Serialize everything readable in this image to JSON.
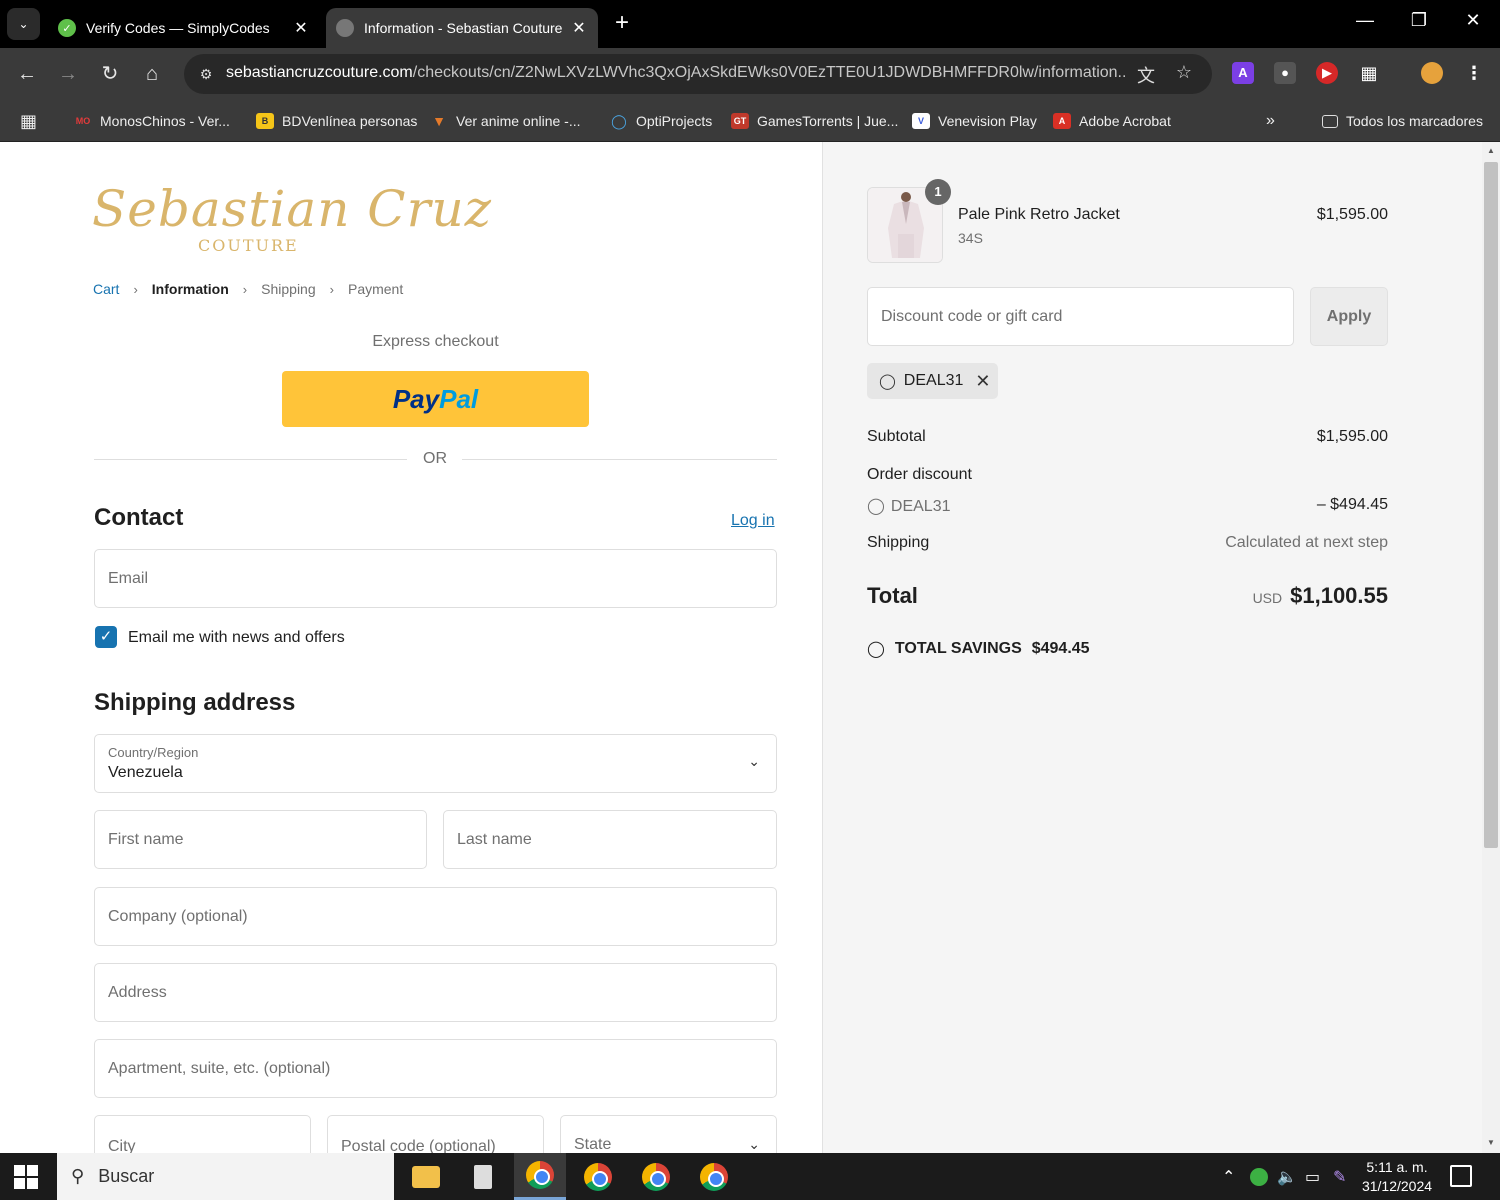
{
  "browser": {
    "tabs": [
      {
        "title": "Verify Codes — SimplyCodes",
        "favicon": "simplycodes-icon"
      },
      {
        "title": "Information - Sebastian Couture",
        "favicon": "globe-icon"
      }
    ],
    "url_host": "sebastiancruzcouture.com",
    "url_path": "/checkouts/cn/Z2NwLXVzLWVhc3QxOjAxSkdEWks0V0EzTTE0U1JDWDBHMFFDR0lw/information...",
    "bookmarks": [
      {
        "label": "MonosChinos - Ver...",
        "icon": "mo",
        "color": "#e23b3b"
      },
      {
        "label": "BDVenlínea personas",
        "icon": "bdv",
        "color": "#f5c518"
      },
      {
        "label": "Ver anime online -...",
        "icon": "anime",
        "color": "#e57a2a"
      },
      {
        "label": "OptiProjects",
        "icon": "O",
        "color": "#4aa3df"
      },
      {
        "label": "GamesTorrents | Jue...",
        "icon": "GT",
        "color": "#c0392b"
      },
      {
        "label": "Venevision Play",
        "icon": "V",
        "color": "#3b5bdb"
      },
      {
        "label": "Adobe Acrobat",
        "icon": "A",
        "color": "#d93025"
      }
    ],
    "all_bookmarks": "Todos los marcadores"
  },
  "checkout": {
    "brand": {
      "script": "Sebastian Cruz",
      "sub": "COUTURE"
    },
    "breadcrumb": {
      "cart": "Cart",
      "information": "Information",
      "shipping": "Shipping",
      "payment": "Payment"
    },
    "express_checkout": "Express checkout",
    "paypal": {
      "part1": "Pay",
      "part2": "Pal"
    },
    "or": "OR",
    "contact": {
      "heading": "Contact",
      "login": "Log in",
      "email_placeholder": "Email",
      "newsletter": "Email me with news and offers"
    },
    "shipping": {
      "heading": "Shipping address",
      "country_label": "Country/Region",
      "country_value": "Venezuela",
      "first_name": "First name",
      "last_name": "Last name",
      "company": "Company (optional)",
      "address": "Address",
      "apartment": "Apartment, suite, etc. (optional)",
      "city": "City",
      "postal": "Postal code (optional)",
      "state": "State"
    }
  },
  "summary": {
    "item": {
      "name": "Pale Pink Retro Jacket",
      "variant": "34S",
      "price": "$1,595.00",
      "quantity": "1"
    },
    "discount_placeholder": "Discount code or gift card",
    "apply": "Apply",
    "applied_code": "DEAL31",
    "subtotal_label": "Subtotal",
    "subtotal": "$1,595.00",
    "order_discount_label": "Order discount",
    "discount_code": "DEAL31",
    "discount_amount": "– $494.45",
    "shipping_label": "Shipping",
    "shipping_value": "Calculated at next step",
    "total_label": "Total",
    "currency": "USD",
    "total": "$1,100.55",
    "savings_label": "TOTAL SAVINGS",
    "savings": "$494.45"
  },
  "taskbar": {
    "search": "Buscar",
    "time": "5:11 a. m.",
    "date": "31/12/2024"
  }
}
